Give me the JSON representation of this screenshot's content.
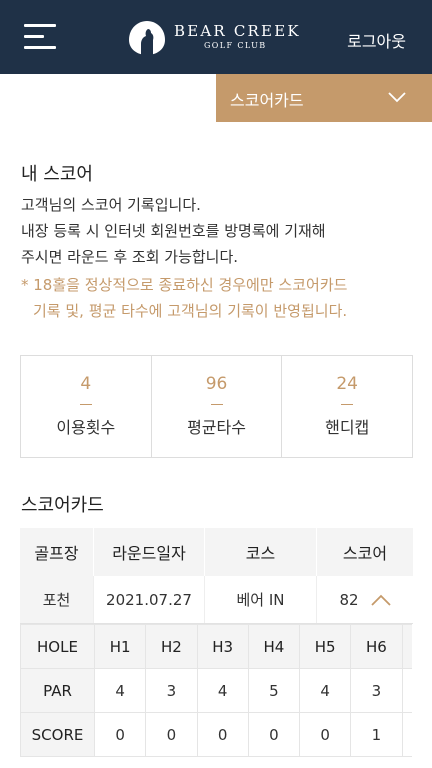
{
  "header": {
    "logo_line1": "BEAR CREEK",
    "logo_line2": "GOLF CLUB",
    "logout_label": "로그아웃"
  },
  "dropdown": {
    "selected": "스코어카드"
  },
  "my_score": {
    "title": "내 스코어",
    "desc_lines": [
      "고객님의 스코어 기록입니다.",
      "내장 등록 시 인터넷 회원번호를 방명록에 기재해",
      "주시면 라운드 후 조회 가능합니다."
    ],
    "notice_lines": [
      "* 18홀을 정상적으로 종료하신 경우에만 스코어카드",
      "기록 및, 평균 타수에 고객님의 기록이 반영됩니다."
    ]
  },
  "stats": [
    {
      "value": "4",
      "label": "이용횟수"
    },
    {
      "value": "96",
      "label": "평균타수"
    },
    {
      "value": "24",
      "label": "핸디캡"
    }
  ],
  "scorecard": {
    "title": "스코어카드",
    "headers": [
      "골프장",
      "라운드일자",
      "코스",
      "스코어"
    ],
    "rows": [
      {
        "club": "포천",
        "date": "2021.07.27",
        "course": "베어 IN",
        "score": "82"
      }
    ]
  },
  "holes": {
    "row_labels": [
      "HOLE",
      "PAR",
      "SCORE"
    ],
    "hole": [
      "H1",
      "H2",
      "H3",
      "H4",
      "H5",
      "H6"
    ],
    "par": [
      "4",
      "3",
      "4",
      "5",
      "4",
      "3"
    ],
    "score": [
      "0",
      "0",
      "0",
      "0",
      "0",
      "1"
    ]
  },
  "colors": {
    "header_bg": "#1f3147",
    "accent": "#c59a6b",
    "table_header_bg": "#f4f4f4"
  },
  "icons": {
    "menu": "hamburger-icon",
    "logo": "bear-emblem-icon",
    "dropdown": "chevron-down-icon",
    "expand": "chevron-up-icon"
  }
}
